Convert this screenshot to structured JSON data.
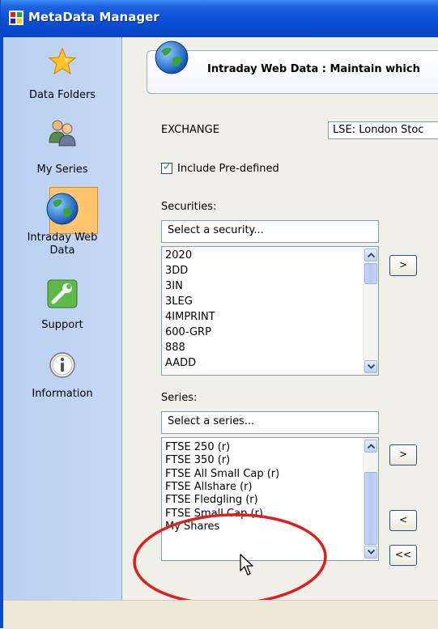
{
  "window": {
    "title": "MetaData Manager"
  },
  "sidebar": {
    "items": [
      {
        "label": "Data Folders",
        "icon": "star-icon"
      },
      {
        "label": "My Series",
        "icon": "users-icon"
      },
      {
        "label": "Intraday Web Data",
        "label_line1": "Intraday Web",
        "label_line2": "Data",
        "icon": "globe-icon",
        "selected": true
      },
      {
        "label": "Support",
        "icon": "wrench-icon"
      },
      {
        "label": "Information",
        "icon": "info-icon"
      }
    ]
  },
  "main": {
    "banner_text": "Intraday Web Data : Maintain which",
    "exchange_label": "EXCHANGE",
    "exchange_value": "LSE: London Stoc",
    "include_predefined_label": "Include Pre-defined",
    "include_predefined_checked": true,
    "securities_label": "Securities:",
    "security_search_text": "Select a security...",
    "securities": [
      "2020",
      "3DD",
      "3IN",
      "3LEG",
      "4IMPRINT",
      "600-GRP",
      "888",
      "AADD"
    ],
    "series_label": "Series:",
    "series_search_text": "Select a series...",
    "series": [
      "FTSE 250 (r)",
      "FTSE 350 (r)",
      "FTSE All Small Cap (r)",
      "FTSE Allshare (r)",
      "FTSE Fledgling (r)",
      "FTSE Small Cap (r)",
      "My Shares"
    ],
    "buttons": {
      "add_security": ">",
      "add_series": ">",
      "remove_series": "<",
      "remove_all_series": "<<"
    }
  },
  "colors": {
    "titlebar": "#0a4fd6",
    "sidebar": "#c0d5f4",
    "selected_nav": "#ffc46c",
    "annotation": "#e0201c"
  }
}
